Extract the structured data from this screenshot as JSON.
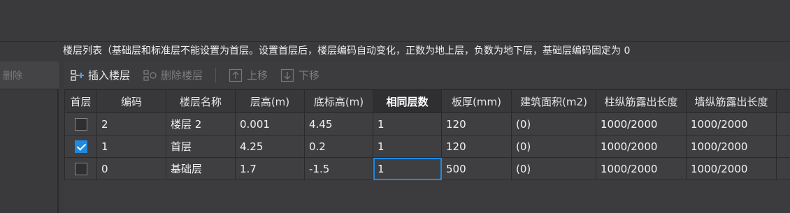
{
  "left_panel": {
    "delete_label": "删除"
  },
  "description": "楼层列表（基础层和标准层不能设置为首层。设置首层后，楼层编码自动变化，正数为地上层，负数为地下层，基础层编码固定为 0",
  "toolbar": {
    "insert_label": "插入楼层",
    "delete_label": "删除楼层",
    "up_label": "上移",
    "down_label": "下移"
  },
  "table": {
    "headers": [
      "首层",
      "编码",
      "楼层名称",
      "层高(m)",
      "底标高(m)",
      "相同层数",
      "板厚(mm)",
      "建筑面积(m2)",
      "柱纵筋露出长度",
      "墙纵筋露出长度"
    ],
    "rows": [
      {
        "first": false,
        "code": "2",
        "name": "楼层 2",
        "height": "0.001",
        "bottom": "4.45",
        "same": "1",
        "thick": "120",
        "area": "(0)",
        "col": "1000/2000",
        "wall": "1000/2000"
      },
      {
        "first": true,
        "code": "1",
        "name": "首层",
        "height": "4.25",
        "bottom": "0.2",
        "same": "1",
        "thick": "120",
        "area": "(0)",
        "col": "1000/2000",
        "wall": "1000/2000"
      },
      {
        "first": false,
        "code": "0",
        "name": "基础层",
        "height": "1.7",
        "bottom": "-1.5",
        "same": "1",
        "thick": "500",
        "area": "(0)",
        "col": "1000/2000",
        "wall": "1000/2000"
      }
    ]
  },
  "colors": {
    "accent": "#1b8ae6",
    "background": "#3a3a3d"
  }
}
